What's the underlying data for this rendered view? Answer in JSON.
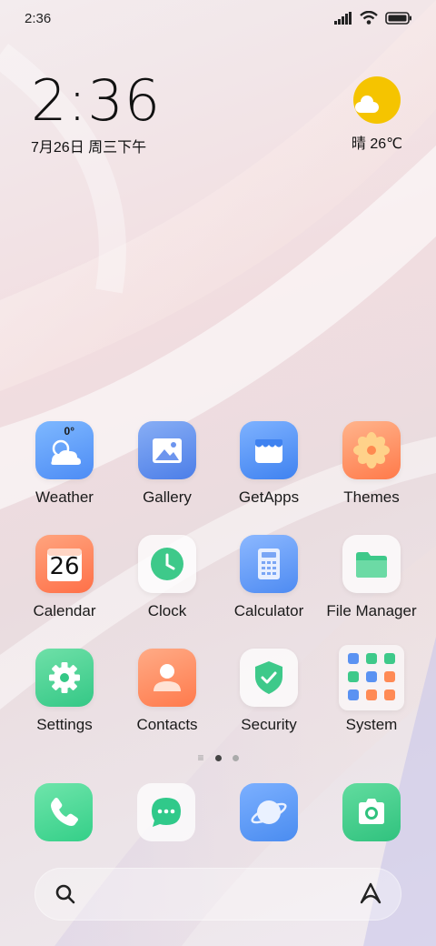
{
  "status_bar": {
    "time": "2:36",
    "icons": [
      "signal-icon",
      "wifi-icon",
      "battery-icon"
    ]
  },
  "clock_widget": {
    "time": "2:36",
    "date": "7月26日 周三下午"
  },
  "weather_widget": {
    "icon": "sun-cloud-icon",
    "text": "晴 26℃",
    "color": "#f5c400"
  },
  "apps": [
    {
      "label": "Weather",
      "icon": "weather-icon",
      "temp": "0°"
    },
    {
      "label": "Gallery",
      "icon": "gallery-icon"
    },
    {
      "label": "GetApps",
      "icon": "getapps-icon"
    },
    {
      "label": "Themes",
      "icon": "themes-icon"
    },
    {
      "label": "Calendar",
      "icon": "calendar-icon",
      "day": "26"
    },
    {
      "label": "Clock",
      "icon": "clock-icon"
    },
    {
      "label": "Calculator",
      "icon": "calculator-icon"
    },
    {
      "label": "File Manager",
      "icon": "file-manager-icon"
    },
    {
      "label": "Settings",
      "icon": "settings-icon"
    },
    {
      "label": "Contacts",
      "icon": "contacts-icon"
    },
    {
      "label": "Security",
      "icon": "security-icon"
    },
    {
      "label": "System",
      "icon": "system-folder-icon"
    }
  ],
  "page_indicator": {
    "pages": 3,
    "current": 2
  },
  "dock": [
    {
      "icon": "phone-icon",
      "color": "#3ed68a"
    },
    {
      "icon": "messages-icon",
      "color": "#30c98a"
    },
    {
      "icon": "browser-icon",
      "color": "#4a8cf0"
    },
    {
      "icon": "camera-icon",
      "color": "#35c985"
    }
  ],
  "search_bar": {
    "left_icon": "search-icon",
    "right_icon": "assistant-icon"
  },
  "colors": {
    "accent_blue": "#4a8cf0",
    "accent_green": "#3ed68a",
    "accent_orange": "#ff8a55"
  }
}
